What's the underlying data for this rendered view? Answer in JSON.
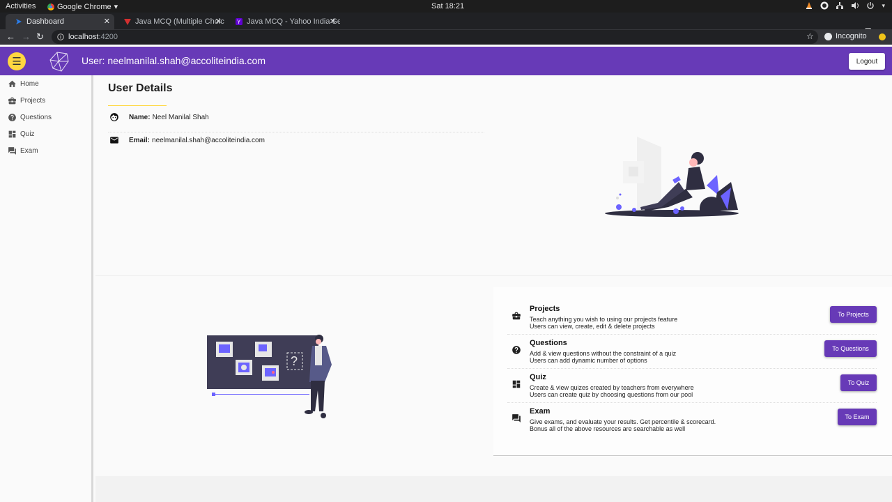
{
  "os_bar": {
    "activities": "Activities",
    "app_name": "Google Chrome",
    "app_caret": "▾",
    "clock": "Sat 18:21"
  },
  "browser": {
    "tabs": [
      {
        "label": "Dashboard",
        "active": true
      },
      {
        "label": "Java MCQ (Multiple Choic",
        "active": false
      },
      {
        "label": "Java MCQ - Yahoo India Se",
        "active": false
      }
    ],
    "url_host": "localhost",
    "url_port": ":4200",
    "incognito_label": "Incognito"
  },
  "header": {
    "title": "User: neelmanilal.shah@accoliteindia.com",
    "logout_label": "Logout",
    "accent": "#673ab7",
    "menu_color": "#ffd740"
  },
  "sidebar": {
    "items": [
      {
        "label": "Home",
        "icon": "home-icon"
      },
      {
        "label": "Projects",
        "icon": "briefcase-icon"
      },
      {
        "label": "Questions",
        "icon": "help-circle-icon"
      },
      {
        "label": "Quiz",
        "icon": "dashboard-icon"
      },
      {
        "label": "Exam",
        "icon": "forum-icon"
      }
    ]
  },
  "user_details": {
    "title": "User Details",
    "name_label": "Name:",
    "name_value": "Neel Manilal Shah",
    "email_label": "Email:",
    "email_value": "neelmanilal.shah@accoliteindia.com"
  },
  "features": [
    {
      "title": "Projects",
      "line1": "Teach anything you wish to using our projects feature",
      "line2": "Users can view, create, edit & delete projects",
      "button": "To Projects",
      "icon": "briefcase-icon"
    },
    {
      "title": "Questions",
      "line1": "Add & view questions without the constraint of a quiz",
      "line2": "Users can add dynamic number of options",
      "button": "To Questions",
      "icon": "help-circle-icon"
    },
    {
      "title": "Quiz",
      "line1": "Create & view quizes created by teachers from everywhere",
      "line2": "Users can create quiz by choosing questions from our pool",
      "button": "To Quiz",
      "icon": "dashboard-icon"
    },
    {
      "title": "Exam",
      "line1": "Give exams, and evaluate your results. Get percentile & scorecard.",
      "line2": "Bonus all of the above resources are searchable as well",
      "button": "To Exam",
      "icon": "forum-icon"
    }
  ]
}
